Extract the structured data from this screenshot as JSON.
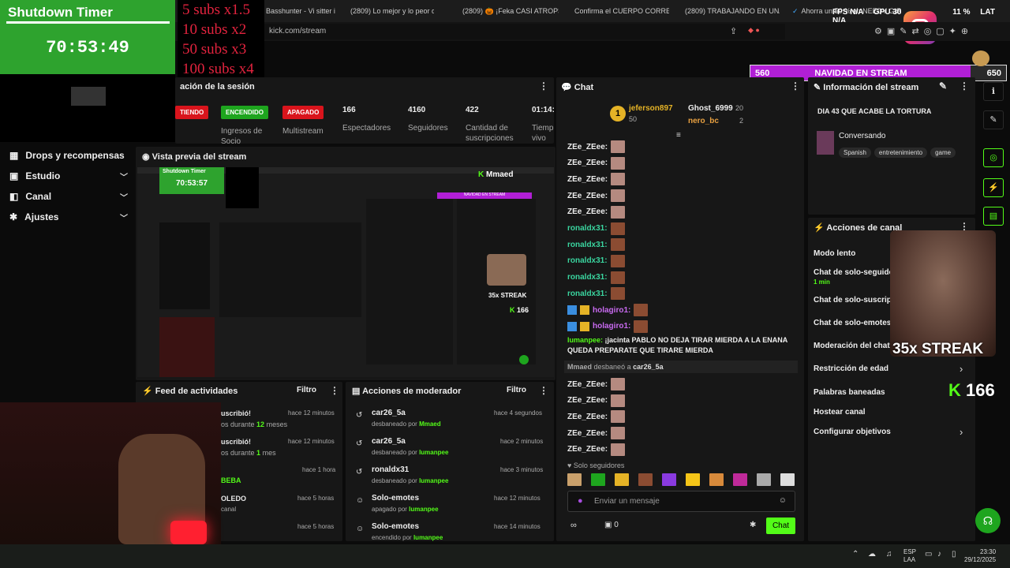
{
  "browser": {
    "tabs": [
      "Basshunter - Vi sitter i v",
      "(2809) Lo mejor y lo peor de 2",
      "(2809) 🎃 ¡Feka CASI ATROP3LI",
      "Confirma el CUERPO CORRECT",
      "(2809) TRABAJANDO EN UNA",
      "Ahorra un 50 % en NEEDY GIR"
    ],
    "address": "kick.com/stream"
  },
  "perf": {
    "fps_label": "FPS",
    "fps_val": "N/A",
    "gpu_label": "GPU",
    "gpu_val": "30",
    "pct": "11 %",
    "lat_label": "LAT",
    "lat_val": "N/A"
  },
  "timer_overlay": {
    "title": "Shutdown Timer",
    "time": "70:53:49"
  },
  "subs_overlay": [
    "5 subs x1.5",
    "10 subs x2",
    "50 subs x3",
    "100 subs x4"
  ],
  "goal_bar": {
    "left": "560",
    "title": "NAVIDAD EN STREAM",
    "right": "650",
    "progress": 0.86
  },
  "nav": [
    {
      "label": "Drops y recompensas",
      "icon": "gift-icon",
      "chevron": false
    },
    {
      "label": "Estudio",
      "icon": "studio-icon",
      "chevron": true
    },
    {
      "label": "Canal",
      "icon": "channel-icon",
      "chevron": true
    },
    {
      "label": "Ajustes",
      "icon": "gear-icon",
      "chevron": true
    }
  ],
  "session": {
    "title": "ación de la sesión",
    "badges": {
      "live": "TIENDO",
      "enabled": "ENCENDIDO",
      "off": "APAGADO"
    },
    "stats": [
      {
        "value": "",
        "label": "Ingresos de Socio"
      },
      {
        "value": "",
        "label": "Multistream"
      },
      {
        "value": "166",
        "label": "Espectadores"
      },
      {
        "value": "4160",
        "label": "Seguidores"
      },
      {
        "value": "422",
        "label": "Cantidad de suscripciones"
      },
      {
        "value": "01:14:",
        "label": "Tiemp vivo"
      }
    ]
  },
  "preview": {
    "title": "Vista previa del stream",
    "inner_timer_title": "Shutdown Timer",
    "inner_timer_time": "70:53:57",
    "host": "Mmaed",
    "inner_goal": "NAVIDAD EN STREAM",
    "streak": "35x STREAK",
    "count": "166"
  },
  "activity": {
    "title": "Feed de actividades",
    "filter": "Filtro",
    "items": [
      {
        "a": "uscribió!",
        "b": "os durante",
        "c": "12",
        "d": "meses",
        "time": "hace 12 minutos"
      },
      {
        "a": "uscribió!",
        "b": "os durante",
        "c": "1",
        "d": "mes",
        "time": "hace 12 minutos"
      },
      {
        "a": "",
        "b": "BEBA",
        "c": "",
        "d": "",
        "time": "hace 1 hora"
      },
      {
        "a": "OLEDO",
        "b": "canal",
        "c": "",
        "d": "",
        "time": "hace 5 horas"
      },
      {
        "a": "",
        "b": "",
        "c": "",
        "d": "",
        "time": "hace 5 horas"
      }
    ]
  },
  "modactions": {
    "title": "Acciones de moderador",
    "filter": "Filtro",
    "items": [
      {
        "name": "car26_5a",
        "action": "desbaneado por",
        "by": "Mmaed",
        "time": "hace 4 segundos",
        "icon": "undo-icon"
      },
      {
        "name": "car26_5a",
        "action": "desbaneado por",
        "by": "lumanpee",
        "time": "hace 2 minutos",
        "icon": "undo-icon"
      },
      {
        "name": "ronaldx31",
        "action": "desbaneado por",
        "by": "lumanpee",
        "time": "hace 3 minutos",
        "icon": "undo-icon"
      },
      {
        "name": "Solo-emotes",
        "action": "apagado por",
        "by": "lumanpee",
        "time": "hace 12 minutos",
        "icon": "emote-icon"
      },
      {
        "name": "Solo-emotes",
        "action": "encendido por",
        "by": "lumanpee",
        "time": "hace 14 minutos",
        "icon": "emote-icon"
      }
    ]
  },
  "chat": {
    "title": "Chat",
    "leaders": [
      {
        "rank": "1",
        "name": "jeferson897",
        "score": "50"
      },
      {
        "name": "Ghost_6999",
        "score": "20"
      },
      {
        "name": "nero_bc",
        "score": "2"
      }
    ],
    "lines": [
      {
        "user": "ZEe_ZEee:",
        "kind": "zee"
      },
      {
        "user": "ZEe_ZEee:",
        "kind": "zee"
      },
      {
        "user": "ZEe_ZEee:",
        "kind": "zee"
      },
      {
        "user": "ZEe_ZEee:",
        "kind": "zee"
      },
      {
        "user": "ZEe_ZEee:",
        "kind": "zee"
      },
      {
        "user": "ronaldx31:",
        "kind": "ron"
      },
      {
        "user": "ronaldx31:",
        "kind": "ron"
      },
      {
        "user": "ronaldx31:",
        "kind": "ron"
      },
      {
        "user": "ronaldx31:",
        "kind": "ron"
      },
      {
        "user": "ronaldx31:",
        "kind": "ron"
      },
      {
        "user": "holagiro1:",
        "kind": "hola"
      },
      {
        "user": "holagiro1:",
        "kind": "hola"
      }
    ],
    "message_user": "lumanpee:",
    "message_text": "¡jacinta PABLO NO DEJA TIRAR MIERDA A LA ENANA QUEDA PREPARATE QUE TIRARE MIERDA",
    "event_actor": "Mmaed",
    "event_text": "desbaneó a",
    "event_target": "car26_5a",
    "lines2": [
      "ZEe_ZEee:",
      "ZEe_ZEee:",
      "ZEe_ZEee:",
      "ZEe_ZEee:",
      "ZEe_ZEee:"
    ],
    "followers_only": "Solo seguidores",
    "input_placeholder": "Enviar un mensaje",
    "points": "0",
    "send": "Chat"
  },
  "stream_info": {
    "title": "Información del stream",
    "stream_title": "DIA 43 QUE ACABE LA TORTURA",
    "category": "Conversando",
    "tags": [
      "Spanish",
      "entretenimiento",
      "game"
    ]
  },
  "channel_actions": {
    "title": "Acciones de canal",
    "items": [
      {
        "label": "Modo lento",
        "sub": ""
      },
      {
        "label": "Chat de solo-seguido",
        "sub": "1 min"
      },
      {
        "label": "Chat de solo-suscript",
        "sub": ""
      },
      {
        "label": "Chat de solo-emotes",
        "sub": ""
      },
      {
        "label": "Moderación del chat co",
        "sub": ""
      },
      {
        "label": "Restricción de edad",
        "sub": ""
      },
      {
        "label": "Palabras baneadas",
        "sub": ""
      },
      {
        "label": "Hostear canal",
        "sub": ""
      },
      {
        "label": "Configurar objetivos",
        "sub": ""
      }
    ],
    "streak": "35x STREAK",
    "count": "166"
  },
  "taskbar": {
    "lang1": "ESP",
    "lang2": "LAA",
    "time": "23:30",
    "date": "29/12/2025"
  },
  "colors": {
    "kick_green": "#53fc18",
    "timer_green": "#2ea32e",
    "goal_purple": "#b11fd6",
    "sub_red": "#e2233e"
  }
}
